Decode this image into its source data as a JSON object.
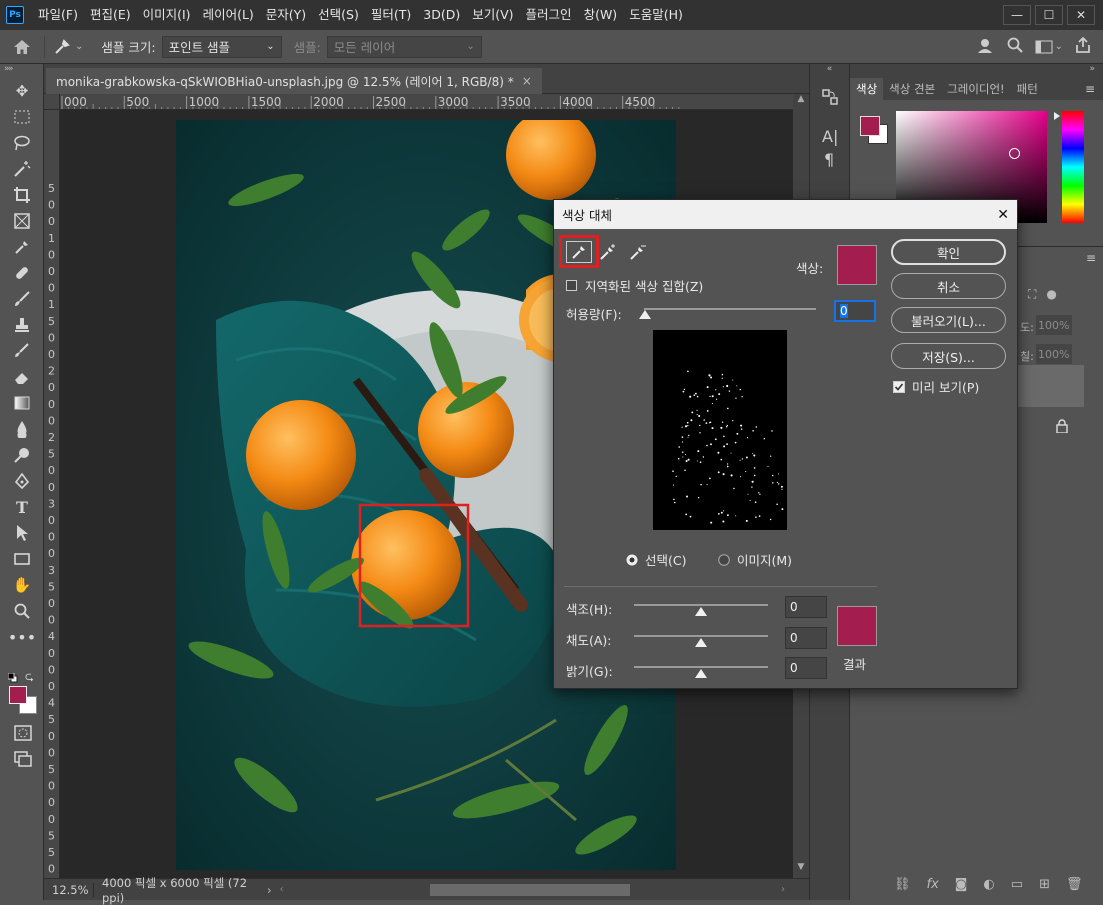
{
  "menubar": {
    "logo": "Ps",
    "items": [
      "파일(F)",
      "편집(E)",
      "이미지(I)",
      "레이어(L)",
      "문자(Y)",
      "선택(S)",
      "필터(T)",
      "3D(D)",
      "보기(V)",
      "플러그인",
      "창(W)",
      "도움말(H)"
    ],
    "window_controls": [
      "—",
      "☐",
      "✕"
    ]
  },
  "options": {
    "sample_size_label": "샘플 크기:",
    "sample_size_value": "포인트 샘플",
    "sample_label": "샘플:",
    "sample_value": "모든 레이어"
  },
  "document": {
    "tab_title": "monika-grabkowska-qSkWIOBHia0-unsplash.jpg @ 12.5% (레이어 1, RGB/8) *",
    "tab_close": "×",
    "ruler_h_ticks": [
      "000",
      "500",
      "1000",
      "1500",
      "2000",
      "2500",
      "3000",
      "3500",
      "4000",
      "4500"
    ],
    "ruler_v_digits": [
      "5",
      "0",
      "0",
      "1",
      "0",
      "0",
      "0",
      "1",
      "5",
      "0",
      "0",
      "2",
      "0",
      "0",
      "0",
      "2",
      "5",
      "0",
      "0",
      "3",
      "0",
      "0",
      "0",
      "3",
      "5",
      "0",
      "0",
      "4",
      "0",
      "0",
      "0",
      "4",
      "5",
      "0",
      "0",
      "5",
      "0",
      "0",
      "0",
      "5",
      "5",
      "0",
      "0"
    ]
  },
  "status": {
    "zoom": "12.5%",
    "dimensions": "4000 픽셀 x 6000 픽셀 (72 ppi)",
    "arrow": "›"
  },
  "colors": {
    "foreground": "#a31d4e",
    "background": "#ffffff",
    "selection_box": "#e02020",
    "photo_bg": "#0d3b3e"
  },
  "panels": {
    "tabs": [
      "색상",
      "색상 견본",
      "그레이디언!",
      "패턴"
    ],
    "layer_opacity_label": "도:",
    "layer_opacity_value": "100%",
    "layer_fill_label": "칠:",
    "layer_fill_value": "100%"
  },
  "dialog": {
    "title": "색상 대체",
    "close": "✕",
    "localized_label": "지역화된 색상 집합(Z)",
    "localized_checked": false,
    "color_label": "색상:",
    "fuzziness_label": "허용량(F):",
    "fuzziness_value": "0",
    "radio_selection": "선택(C)",
    "radio_image": "이미지(M)",
    "selected_radio": "선택(C)",
    "hue_label": "색조(H):",
    "hue_value": "0",
    "saturation_label": "채도(A):",
    "saturation_value": "0",
    "lightness_label": "밝기(G):",
    "lightness_value": "0",
    "result_label": "결과",
    "buttons": {
      "ok": "확인",
      "cancel": "취소",
      "load": "불러오기(L)...",
      "save": "저장(S)..."
    },
    "preview_label": "미리 보기(P)",
    "preview_checked": true,
    "sample_color": "#a31d4e",
    "result_color": "#a31d4e"
  }
}
